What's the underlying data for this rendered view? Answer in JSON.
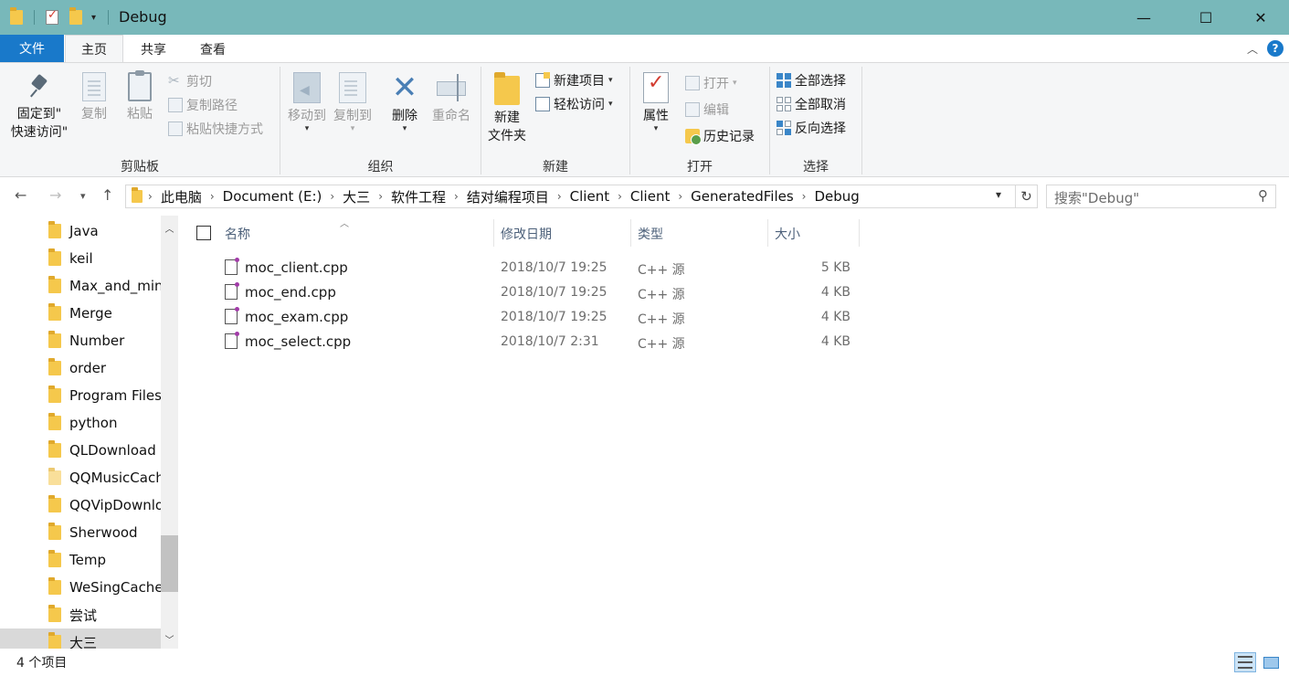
{
  "window": {
    "title": "Debug",
    "controls": {
      "minimize": "—",
      "maximize": "☐",
      "close": "✕"
    }
  },
  "ribbon_tabs": {
    "file": "文件",
    "items": [
      "主页",
      "共享",
      "查看"
    ],
    "active": "主页"
  },
  "ribbon": {
    "clipboard": {
      "label": "剪贴板",
      "pin_line1": "固定到\"",
      "pin_line2": "快速访问\"",
      "copy": "复制",
      "paste": "粘贴",
      "cut": "剪切",
      "copy_path": "复制路径",
      "paste_shortcut": "粘贴快捷方式"
    },
    "organize": {
      "label": "组织",
      "move_to": "移动到",
      "copy_to": "复制到",
      "delete": "删除",
      "rename": "重命名"
    },
    "new": {
      "label": "新建",
      "new_folder_line1": "新建",
      "new_folder_line2": "文件夹",
      "new_item": "新建项目",
      "easy_access": "轻松访问"
    },
    "open": {
      "label": "打开",
      "properties": "属性",
      "open": "打开",
      "edit": "编辑",
      "history": "历史记录"
    },
    "select": {
      "label": "选择",
      "select_all": "全部选择",
      "select_none": "全部取消",
      "invert": "反向选择"
    }
  },
  "address": {
    "crumbs": [
      "此电脑",
      "Document (E:)",
      "大三",
      "软件工程",
      "结对编程项目",
      "Client",
      "Client",
      "GeneratedFiles",
      "Debug"
    ]
  },
  "search": {
    "placeholder": "搜索\"Debug\""
  },
  "nav_pane": {
    "items": [
      "Java",
      "keil",
      "Max_and_min",
      "Merge",
      "Number",
      "order",
      "Program Files",
      "python",
      "QLDownload",
      "QQMusicCache",
      "QQVipDownload",
      "Sherwood",
      "Temp",
      "WeSingCache",
      "尝试",
      "大三"
    ],
    "selected": "大三"
  },
  "columns": {
    "name": "名称",
    "modified": "修改日期",
    "type": "类型",
    "size": "大小"
  },
  "files": [
    {
      "name": "moc_client.cpp",
      "modified": "2018/10/7 19:25",
      "type": "C++ 源",
      "size": "5 KB"
    },
    {
      "name": "moc_end.cpp",
      "modified": "2018/10/7 19:25",
      "type": "C++ 源",
      "size": "4 KB"
    },
    {
      "name": "moc_exam.cpp",
      "modified": "2018/10/7 19:25",
      "type": "C++ 源",
      "size": "4 KB"
    },
    {
      "name": "moc_select.cpp",
      "modified": "2018/10/7 2:31",
      "type": "C++ 源",
      "size": "4 KB"
    }
  ],
  "status": {
    "item_count": "4 个项目"
  },
  "colors": {
    "titlebar": "#78b8ba",
    "file_tab": "#1979ca",
    "folder": "#f5c84c"
  }
}
